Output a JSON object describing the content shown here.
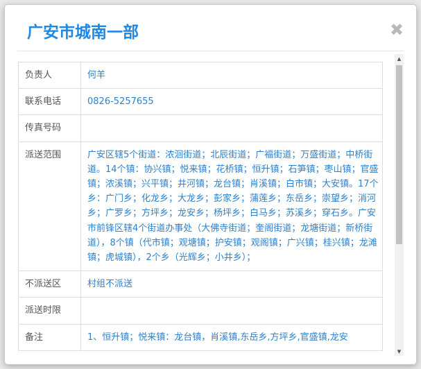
{
  "dialog": {
    "title": "广安市城南一部",
    "close_symbol": "✖"
  },
  "rows": [
    {
      "label": "负责人",
      "value": "何羊"
    },
    {
      "label": "联系电话",
      "value": "0826-5257655"
    },
    {
      "label": "传真号码",
      "value": ""
    },
    {
      "label": "派送范围",
      "value": "广安区辖5个街道：浓洄街道；北辰街道；广福街道；万盛街道；中桥街道。14个镇：协兴镇；悦来镇；花桥镇；恒升镇；石笋镇；枣山镇；官盛镇；浓溪镇；兴平镇；井河镇；龙台镇；肖溪镇；白市镇；大安镇。17个乡：广门乡；化龙乡；大龙乡；彭家乡；蒲莲乡；东岳乡；崇望乡；消河乡；广罗乡；方坪乡；龙安乡；杨坪乡；白马乡；苏溪乡；穿石乡。广安市前锋区辖4个街道办事处（大佛寺街道；奎阁街道；龙塘街道；新桥街道），8个镇（代市镇；观塘镇；护安镇；观阁镇；广兴镇；桂兴镇；龙滩镇；虎城镇），2个乡（光辉乡；小井乡）；"
    },
    {
      "label": "不派送区",
      "value": "村组不派送"
    },
    {
      "label": "派送时限",
      "value": ""
    },
    {
      "label": "备注",
      "value": "1、恒升镇；悦来镇：龙台镇，肖溪镇,东岳乡,方坪乡,官盛镇,龙安"
    }
  ],
  "scrollbar": {
    "up_arrow": "▲",
    "down_arrow": "▼"
  }
}
